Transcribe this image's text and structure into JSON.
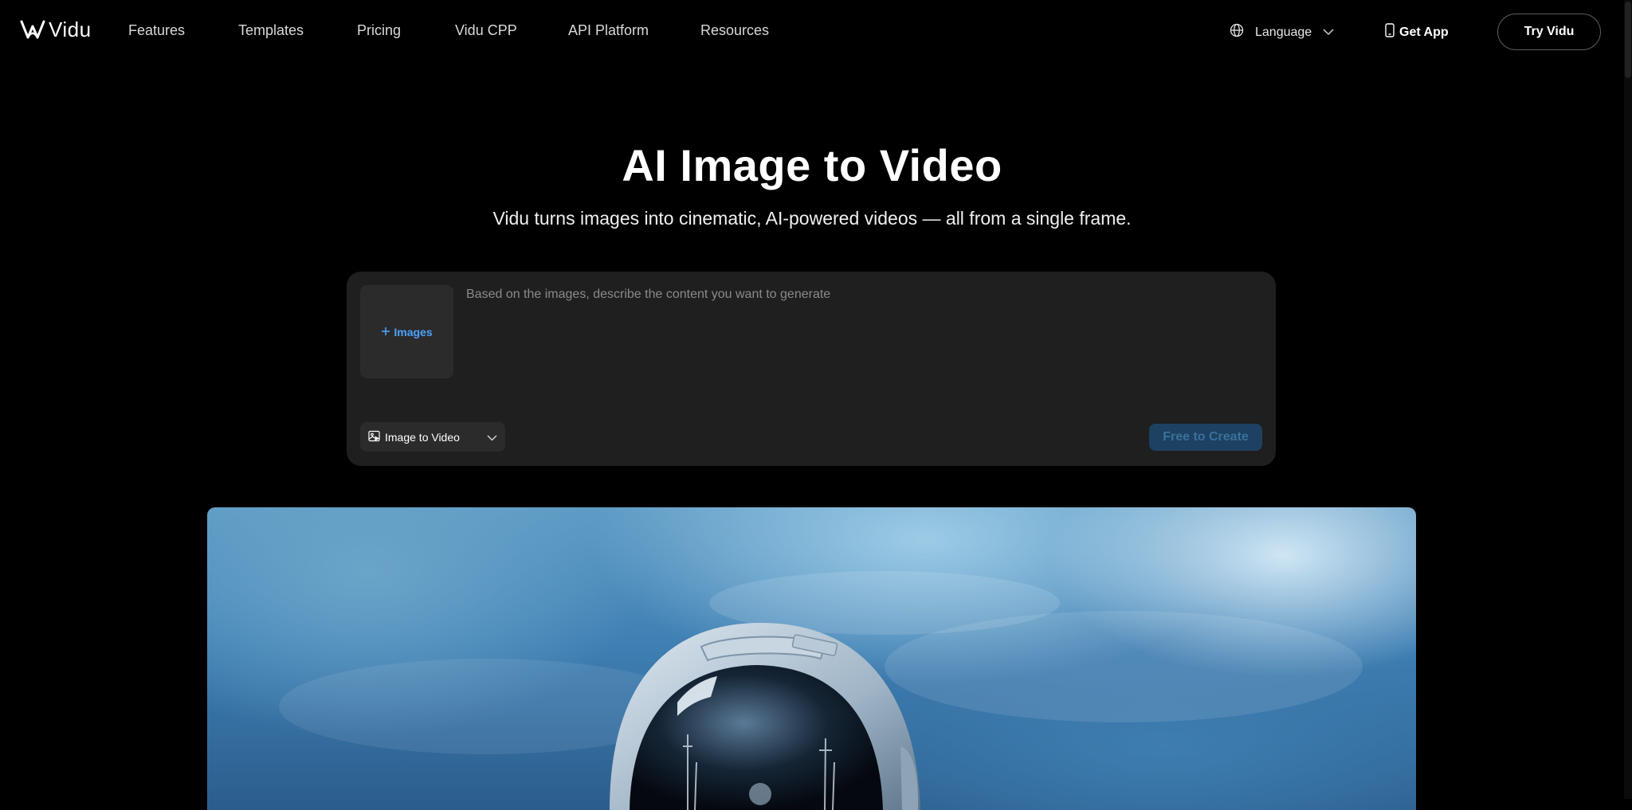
{
  "brand": {
    "name": "Vidu"
  },
  "nav": {
    "links": [
      "Features",
      "Templates",
      "Pricing",
      "Vidu CPP",
      "API Platform",
      "Resources"
    ],
    "language_label": "Language",
    "get_app_label": "Get App",
    "try_label": "Try Vidu"
  },
  "hero": {
    "title": "AI Image to Video",
    "subtitle": "Vidu turns images into cinematic, AI-powered videos — all from a single frame."
  },
  "prompt_card": {
    "upload_label": "Images",
    "placeholder": "Based on the images, describe the content you want to generate",
    "mode_value": "Image to Video",
    "create_label": "Free to Create"
  },
  "colors": {
    "accent": "#4aa3ff",
    "background": "#000000",
    "card": "#1f1f1f",
    "create_button_disabled": "#1d4161"
  },
  "icons": {
    "language": "globe-icon",
    "get_app": "phone-icon",
    "upload": "plus-icon",
    "mode": "image-video-icon",
    "dropdown": "chevron-down-icon"
  }
}
